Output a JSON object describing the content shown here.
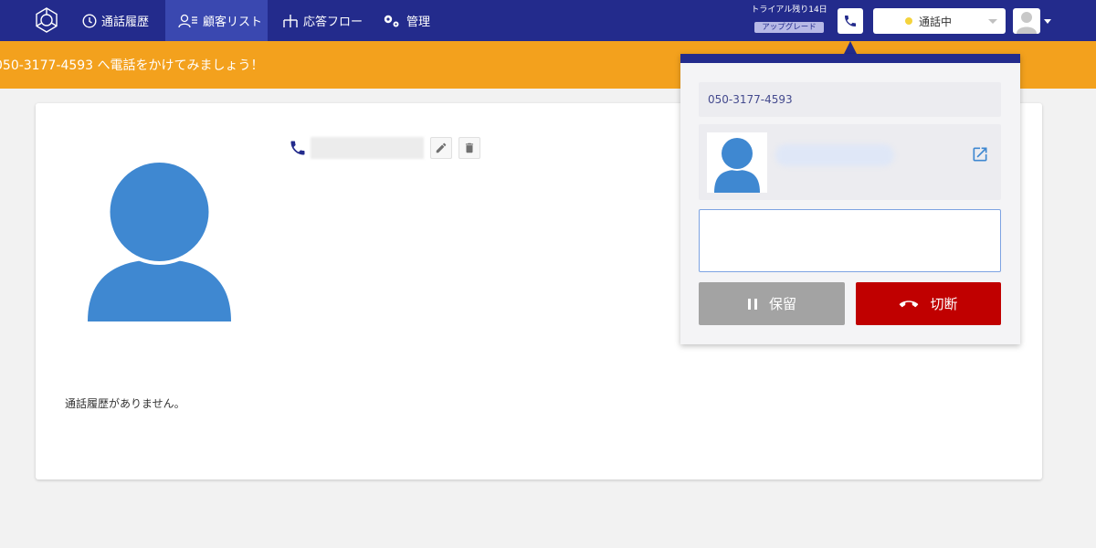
{
  "nav": {
    "items": [
      {
        "label": "通話履歴",
        "icon": "clock-icon"
      },
      {
        "label": "顧客リスト",
        "icon": "customer-list-icon",
        "active": true
      },
      {
        "label": "応答フロー",
        "icon": "flow-icon"
      },
      {
        "label": "管理",
        "icon": "gears-icon"
      }
    ],
    "trial_text": "トライアル残り14日",
    "upgrade_label": "アップグレード",
    "status_label": "通話中",
    "status_color": "#f4d33c"
  },
  "banner": {
    "text": "050-3177-4593 へ電話をかけてみましょう！",
    "color": "#f3a11d"
  },
  "contact_card": {
    "empty_history": "通話履歴がありません。"
  },
  "call_popup": {
    "number": "050-3177-4593",
    "memo_value": "",
    "hold_label": "保留",
    "hangup_label": "切断",
    "hangup_color": "#c00000"
  },
  "colors": {
    "nav_bg": "#232b8c",
    "accent_blue": "#3f88d1"
  }
}
